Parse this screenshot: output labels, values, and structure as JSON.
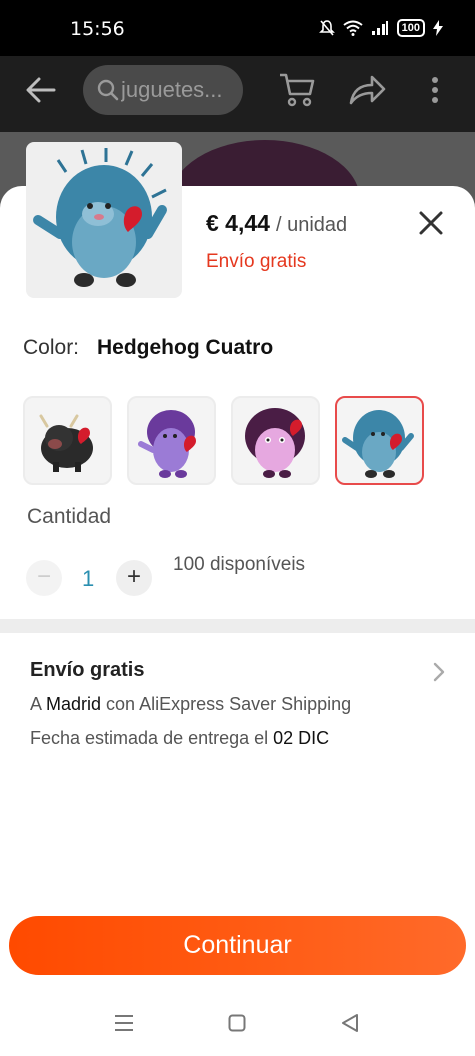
{
  "status_bar": {
    "time": "15:56",
    "battery": "100"
  },
  "app_bar": {
    "search_placeholder": "juguetes..."
  },
  "product": {
    "price": "€ 4,44",
    "unit": "/ unidad",
    "shipping": "Envío gratis"
  },
  "color": {
    "label": "Color:",
    "value": "Hedgehog Cuatro"
  },
  "variants": [
    {
      "name": "Bull black"
    },
    {
      "name": "Hedgehog purple"
    },
    {
      "name": "Hedgehog pink"
    },
    {
      "name": "Hedgehog Cuatro",
      "selected": true
    }
  ],
  "quantity": {
    "label": "Cantidad",
    "minus": "−",
    "value": "1",
    "plus": "+",
    "available": "100 disponíveis"
  },
  "shipping_info": {
    "title": "Envío gratis",
    "line1_prefix": "A ",
    "city": "Madrid",
    "line1_suffix": " con AliExpress Saver Shipping",
    "line2_prefix": "Fecha estimada de entrega el ",
    "date": "02 DIC"
  },
  "actions": {
    "continue": "Continuar"
  },
  "colors": {
    "accent": "#ff5a12",
    "red": "#e5381f",
    "qty_blue": "#2a8fb0"
  }
}
